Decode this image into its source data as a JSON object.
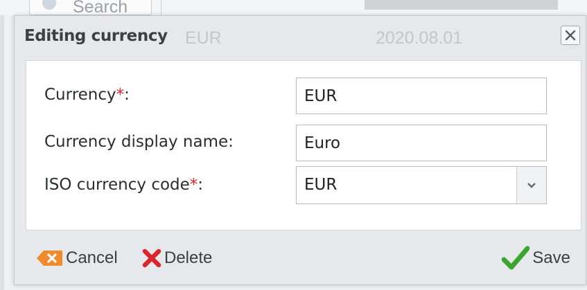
{
  "background": {
    "search_placeholder": "Search",
    "row_code": "EUR",
    "row_date": "2020.08.01"
  },
  "dialog": {
    "title": "Editing currency",
    "close_icon": "close-x-icon"
  },
  "form": {
    "currency": {
      "label": "Currency",
      "required_mark": "*",
      "suffix": ":",
      "value": "EUR"
    },
    "display_name": {
      "label": "Currency display name:",
      "value": "Euro"
    },
    "iso_code": {
      "label": "ISO currency code",
      "required_mark": "*",
      "suffix": ":",
      "value": "EUR"
    }
  },
  "footer": {
    "cancel_label": "Cancel",
    "delete_label": "Delete",
    "save_label": "Save"
  },
  "colors": {
    "required": "#e0252a",
    "cancel_icon": "#f08a2c",
    "delete_icon": "#d8262c",
    "save_icon": "#3aa62e"
  }
}
